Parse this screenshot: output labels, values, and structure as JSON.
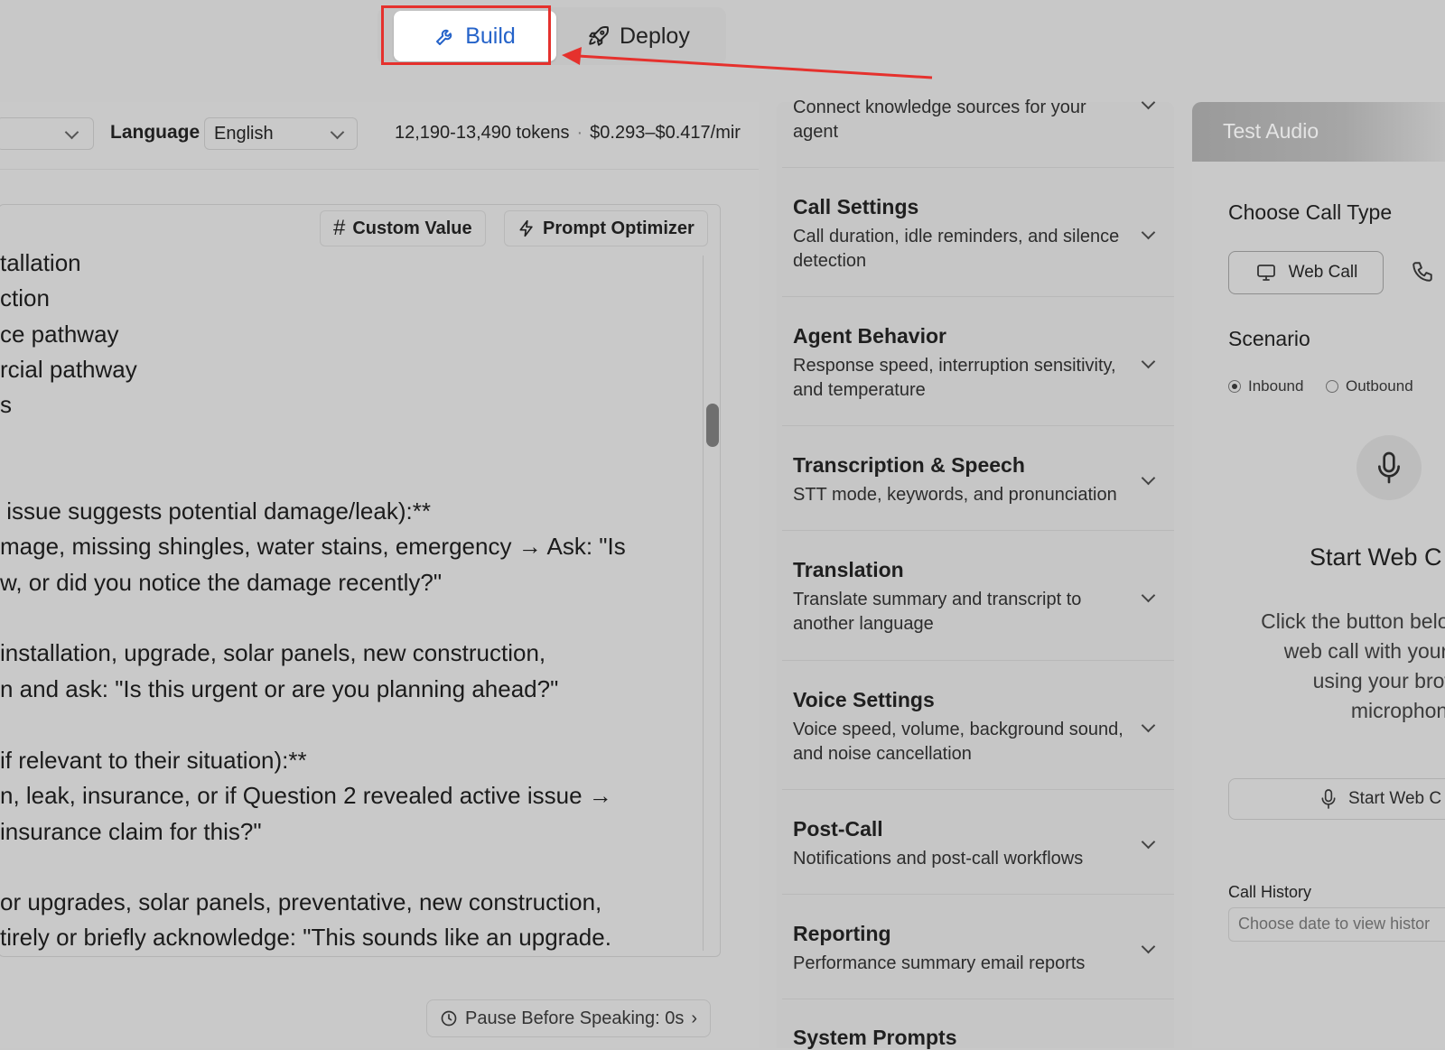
{
  "tabs": {
    "build": "Build",
    "deploy": "Deploy"
  },
  "colors": {
    "accent": "#2563c9",
    "annotation_red": "#e5312d"
  },
  "left": {
    "language_label": "Language",
    "language_value": "English",
    "tokens": "12,190-13,490 tokens",
    "cost": "$0.293–$0.417/mir",
    "custom_value_label": "Custom Value",
    "prompt_optimizer_label": "Prompt Optimizer",
    "editor_lines": [
      "tallation",
      "ction",
      "ce pathway",
      "rcial pathway",
      "s",
      "",
      " issue suggests potential damage/leak):**",
      "mage, missing shingles, water stains, emergency → Ask: \"Is",
      "w, or did you notice the damage recently?\"",
      "",
      "installation, upgrade, solar panels, new construction,",
      "n and ask: \"Is this urgent or are you planning ahead?\"",
      "",
      "if relevant to their situation):**",
      "n, leak, insurance, or if Question 2 revealed active issue →",
      "insurance claim for this?\"",
      "",
      "or upgrades, solar panels, preventative, new construction,",
      "tirely or briefly acknowledge: \"This sounds like an upgrade."
    ],
    "pause_label": "Pause Before Speaking: 0s",
    "pause_chevron": "›"
  },
  "middle": {
    "sections": [
      {
        "title": "",
        "desc": "Connect knowledge sources for your agent"
      },
      {
        "title": "Call Settings",
        "desc": "Call duration, idle reminders, and silence detection"
      },
      {
        "title": "Agent Behavior",
        "desc": "Response speed, interruption sensitivity, and temperature"
      },
      {
        "title": "Transcription & Speech",
        "desc": "STT mode, keywords, and pronunciation"
      },
      {
        "title": "Translation",
        "desc": "Translate summary and transcript to another language"
      },
      {
        "title": "Voice Settings",
        "desc": "Voice speed, volume, background sound, and noise cancellation"
      },
      {
        "title": "Post-Call",
        "desc": "Notifications and post-call workflows"
      },
      {
        "title": "Reporting",
        "desc": "Performance summary email reports"
      },
      {
        "title": "System Prompts",
        "desc": ""
      }
    ]
  },
  "right": {
    "header": "Test Audio",
    "choose_call_type": "Choose Call Type",
    "web_call": "Web Call",
    "scenario": "Scenario",
    "inbound": "Inbound",
    "outbound": "Outbound",
    "start_title": "Start Web C",
    "start_desc_lines": [
      "Click the button belov",
      "web call with your /",
      "using your brow",
      "microphone"
    ],
    "start_button": "Start Web C",
    "call_history": "Call History",
    "history_placeholder": "Choose date to view histor"
  }
}
